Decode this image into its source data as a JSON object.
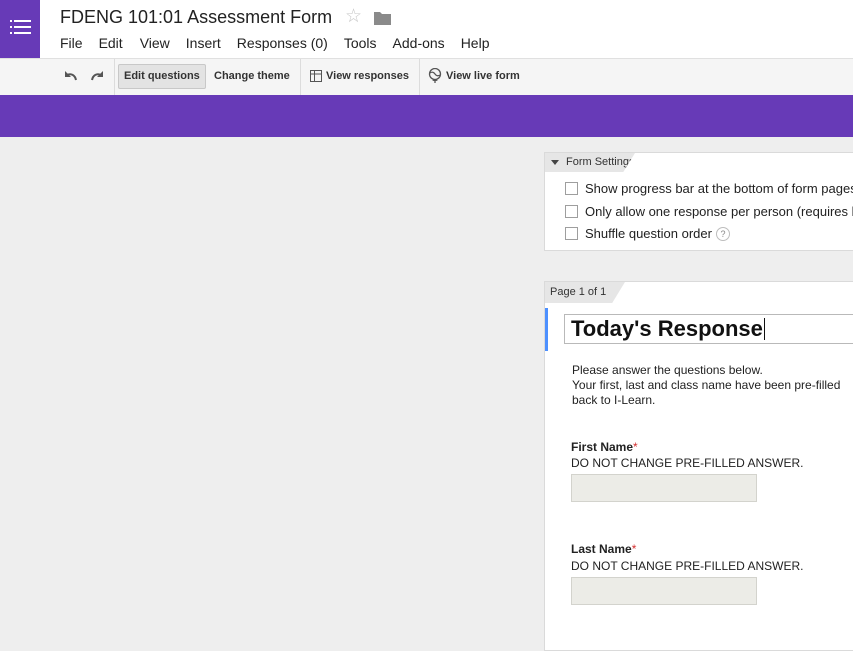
{
  "header": {
    "title": "FDENG 101:01 Assessment Form",
    "menu": [
      "File",
      "Edit",
      "View",
      "Insert",
      "Responses (0)",
      "Tools",
      "Add-ons",
      "Help"
    ]
  },
  "toolbar": {
    "edit_questions": "Edit questions",
    "change_theme": "Change theme",
    "view_responses": "View responses",
    "view_live_form": "View live form"
  },
  "settings": {
    "tab_label": "Form Settings",
    "options": [
      {
        "label": "Show progress bar at the bottom of form pages",
        "checked": false
      },
      {
        "label": "Only allow one response per person (requires login)",
        "checked": false
      },
      {
        "label": "Shuffle question order",
        "checked": false
      }
    ],
    "help_symbol": "?"
  },
  "form": {
    "page_label": "Page 1 of 1",
    "title_value": "Today's Response",
    "description_lines": [
      "Please answer the questions below.",
      "Your first, last and class name have been pre-filled",
      "back to I-Learn."
    ],
    "questions": [
      {
        "title": "First Name",
        "required_mark": "*",
        "help": "DO NOT CHANGE PRE-FILLED ANSWER."
      },
      {
        "title": "Last Name",
        "required_mark": "*",
        "help": "DO NOT CHANGE PRE-FILLED ANSWER."
      }
    ]
  },
  "colors": {
    "brand_purple": "#673ab7",
    "accent_blue": "#4d90fe",
    "required_red": "#d32f2f"
  }
}
